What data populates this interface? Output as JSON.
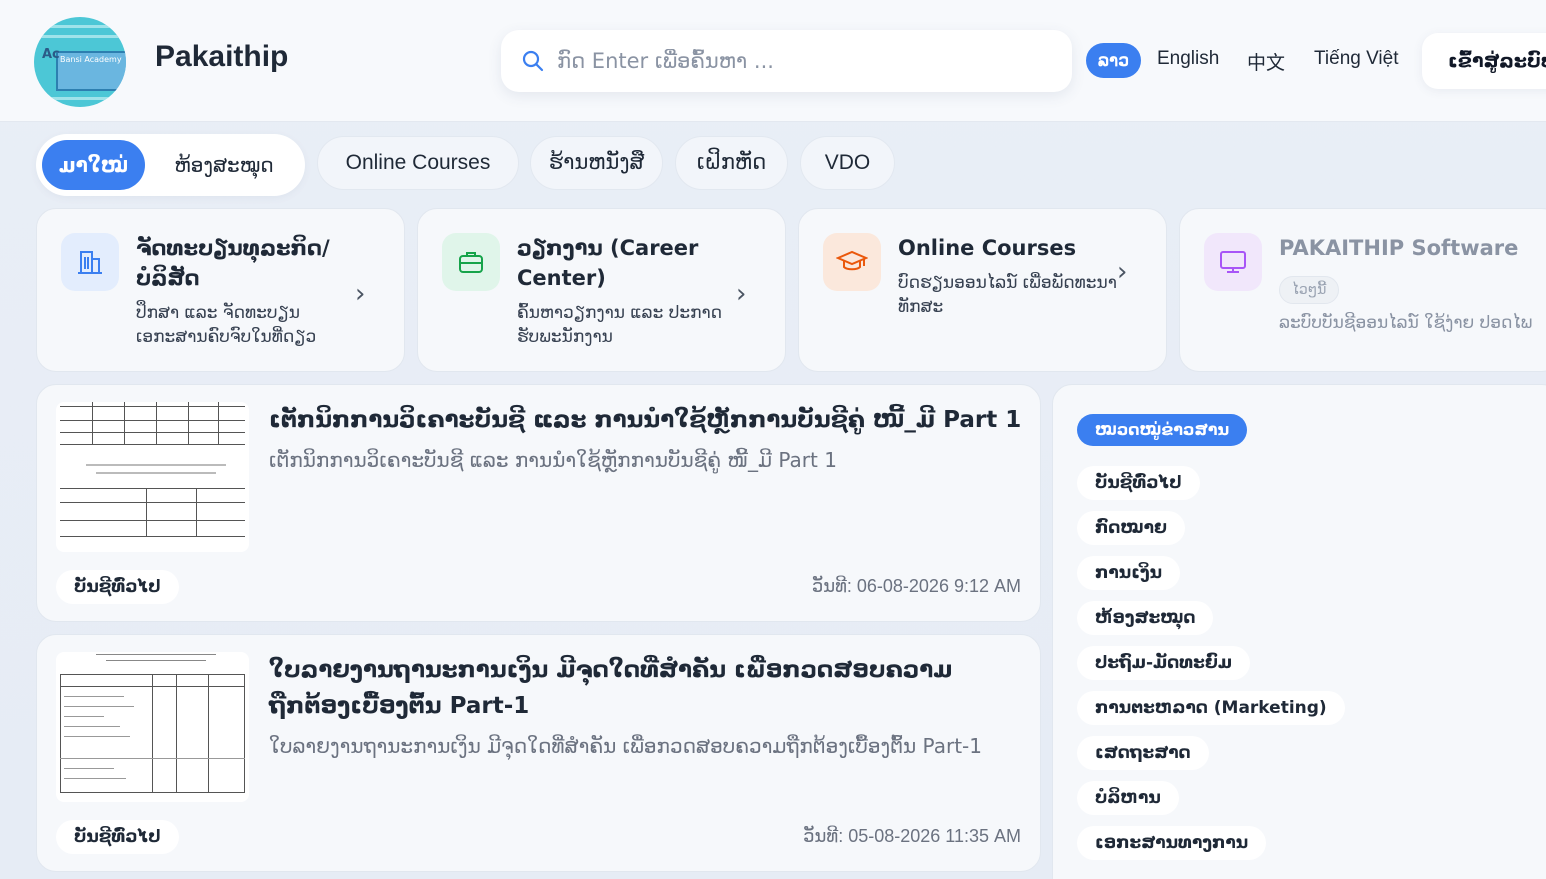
{
  "header": {
    "brand": "Pakaithip",
    "search_placeholder": "ກົດ Enter ເພື່ອຄົ້ນຫາ ...",
    "languages": [
      "ລາວ",
      "English",
      "中文",
      "Tiếng Việt"
    ],
    "login_label": "ເຂົ້າສູ່ລະບົບ",
    "logo_text": "Ac",
    "logo_badge": "Bansi Academy"
  },
  "tabs": {
    "active": "ມາໃໝ່",
    "library": "ຫ້ອງສະໝຸດ",
    "items": [
      "Online Courses",
      "ຮ້ານຫນັງສື",
      "ເຝິກຫັດ",
      "VDO"
    ]
  },
  "services": [
    {
      "title": "ຈັດທະບຽນທຸລະກິດ/ບໍລິສັດ",
      "desc": "ປຶກສາ ແລະ ຈັດທະບຽນ ເອກະສານຄົບຈົບໃນທີ່ດຽວ",
      "icon": "building-icon",
      "color": "#3b7ff0"
    },
    {
      "title": "ວຽກງານ (Career Center)",
      "desc": "ຄົ້ນຫາວຽກງານ ແລະ ປະກາດຮັບພະນັກງານ",
      "icon": "briefcase-icon",
      "color": "#16a34a"
    },
    {
      "title": "Online Courses",
      "desc": "ບົດຮຽນອອນໄລນ໌ ເພື່ອພັດທະນາທັກສະ",
      "icon": "graduation-cap-icon",
      "color": "#ea580c"
    },
    {
      "title": "PAKAITHIP Software",
      "badge": "ໄວໆນີ້",
      "desc": "ລະບົບບັນຊີອອນໄລນ໌ ໃຊ້ງ່າຍ ປອດໄພ",
      "icon": "monitor-icon",
      "color": "#a855f7"
    }
  ],
  "articles": [
    {
      "title": "ເຕັກນິກການວິເຄາະບັນຊີ ແລະ ການນຳໃຊ້ຫຼັກການບັນຊີຄູ່ ໜີ້_ມີ Part 1",
      "subtitle": "ເຕັກນິກການວິເຄາະບັນຊີ ແລະ ການນຳໃຊ້ຫຼັກການບັນຊີຄູ່ ໜີ້_ມີ Part 1",
      "tag": "ບັນຊີທົ່ວໄປ",
      "date": "ວັນທີ: 06-08-2026 9:12 AM"
    },
    {
      "title": "ໃບລາຍງານຖານະການເງິນ ມີຈຸດໃດທີ່ສຳຄັນ ເພື່ອກວດສອບຄວາມຖືກຕ້ອງເບື້ອງຕົ້ນ Part-1",
      "subtitle": "ໃບລາຍງານຖານະການເງິນ ມີຈຸດໃດທີ່ສຳຄັນ ເພື່ອກວດສອບຄວາມຖືກຕ້ອງເບື້ອງຕົ້ນ Part-1",
      "tag": "ບັນຊີທົ່ວໄປ",
      "date": "ວັນທີ: 05-08-2026 11:35 AM"
    }
  ],
  "sidebar": {
    "heading": "ໝວດໝູ່ຂ່າວສານ",
    "categories": [
      "ບັນຊີທົ່ວໄປ",
      "ກົດໝາຍ",
      "ການເງິນ",
      "ຫ້ອງສະໝຸດ",
      "ປະຖົມ-ມັດທະຍົມ",
      "ການຕະຫລາດ (Marketing)",
      "ເສດຖະສາດ",
      "ບໍລິຫານ",
      "ເອກະສານທາງການ"
    ]
  }
}
